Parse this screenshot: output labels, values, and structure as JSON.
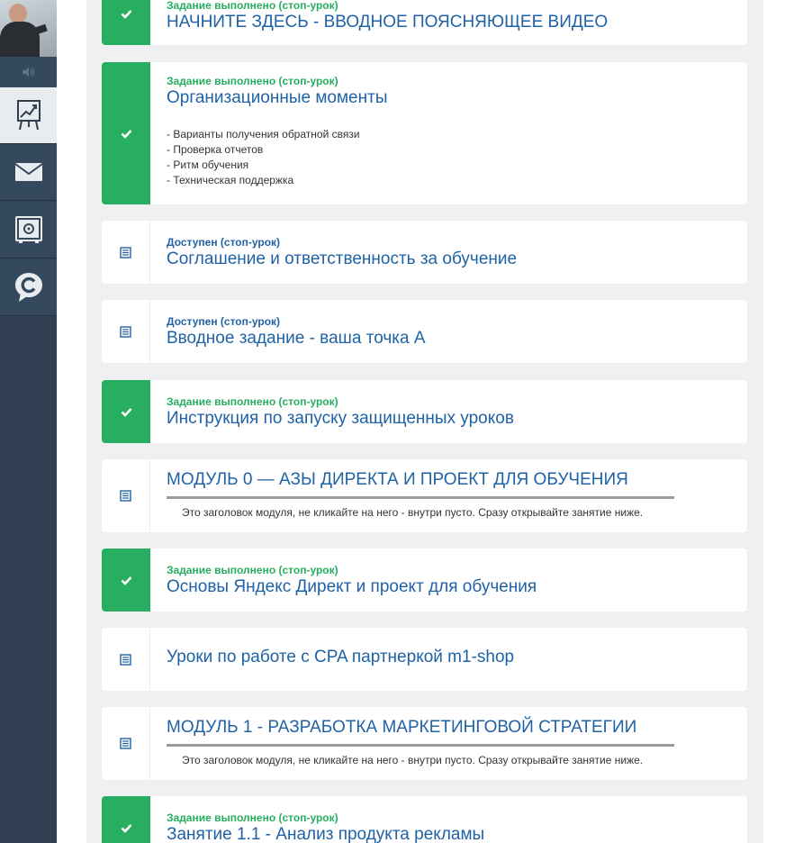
{
  "sidebar": {
    "items": [
      {
        "name": "stats",
        "icon": "chart-presentation-icon",
        "active": true
      },
      {
        "name": "messages",
        "icon": "envelope-icon",
        "active": false
      },
      {
        "name": "safe",
        "icon": "safe-icon",
        "active": false
      },
      {
        "name": "chat",
        "icon": "chat-c-icon",
        "active": false
      }
    ]
  },
  "colors": {
    "done_green": "#27ae60",
    "link_blue": "#1f62a6",
    "sidebar_bg": "#2f3e50"
  },
  "lessons": [
    {
      "state": "done",
      "status": "Задание выполнено (стоп-урок)",
      "title": "НАЧНИТЕ ЗДЕСЬ - ВВОДНОЕ ПОЯСНЯЮЩЕЕ ВИДЕО"
    },
    {
      "state": "done",
      "status": "Задание выполнено (стоп-урок)",
      "title": "Организационные моменты",
      "lines": [
        "- Варианты получения обратной связи",
        "- Проверка отчетов",
        "- Ритм обучения",
        "- Техническая поддержка"
      ]
    },
    {
      "state": "available",
      "status": "Доступен (стоп-урок)",
      "title": "Соглашение и ответственность за обучение"
    },
    {
      "state": "available",
      "status": "Доступен (стоп-урок)",
      "title": "Вводное задание - ваша точка А"
    },
    {
      "state": "done",
      "status": "Задание выполнено (стоп-урок)",
      "title": "Инструкция по запуску защищенных уроков"
    },
    {
      "state": "module",
      "title": "МОДУЛЬ 0 — АЗЫ ДИРЕКТА И ПРОЕКТ ДЛЯ ОБУЧЕНИЯ",
      "note": "Это заголовок модуля, не кликайте на него - внутри пусто. Сразу открывайте занятие ниже."
    },
    {
      "state": "done",
      "status": "Задание выполнено (стоп-урок)",
      "title": "Основы Яндекс Директ и проект для обучения"
    },
    {
      "state": "plain",
      "title": "Уроки по работе с CPA партнеркой m1-shop"
    },
    {
      "state": "module",
      "title": "МОДУЛЬ 1 - РАЗРАБОТКА МАРКЕТИНГОВОЙ СТРАТЕГИИ",
      "note": "Это заголовок модуля, не кликайте на него - внутри пусто. Сразу открывайте занятие ниже."
    },
    {
      "state": "done",
      "status": "Задание выполнено (стоп-урок)",
      "title": "Занятие 1.1 - Анализ продукта рекламы"
    }
  ]
}
